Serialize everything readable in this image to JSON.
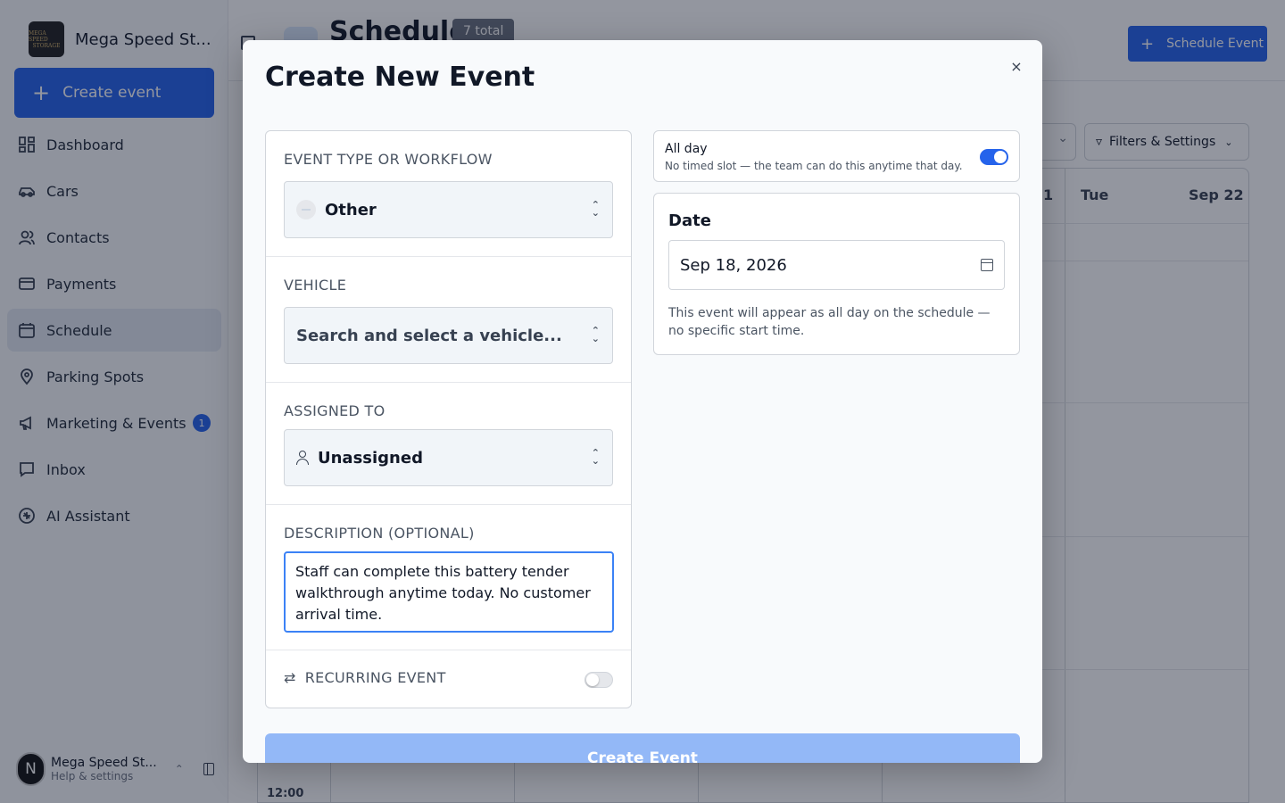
{
  "sidebar": {
    "brand_name": "Mega Speed St...",
    "logo_text": [
      "MEGA SPEED",
      "STORAGE"
    ],
    "create_label": "Create event",
    "items": [
      {
        "label": "Dashboard",
        "icon": "dashboard-icon"
      },
      {
        "label": "Cars",
        "icon": "car-icon"
      },
      {
        "label": "Contacts",
        "icon": "contacts-icon"
      },
      {
        "label": "Payments",
        "icon": "payments-icon"
      },
      {
        "label": "Schedule",
        "icon": "calendar-icon",
        "active": true
      },
      {
        "label": "Parking Spots",
        "icon": "map-pin-icon"
      },
      {
        "label": "Marketing & Events",
        "icon": "megaphone-icon",
        "badge": "1"
      },
      {
        "label": "Inbox",
        "icon": "inbox-icon"
      },
      {
        "label": "AI Assistant",
        "icon": "ai-icon"
      }
    ],
    "user": {
      "initial": "N",
      "name": "Mega Speed St...",
      "sub": "Help & settings"
    }
  },
  "page": {
    "title": "Schedule",
    "total_badge": "7 total",
    "schedule_button": "Schedule Event",
    "filters_button": "Filters & Settings"
  },
  "calendar": {
    "partial_day_digit": "1",
    "day_name": "Tue",
    "day_date": "Sep 22",
    "time_label": "12:00"
  },
  "modal": {
    "title": "Create New Event",
    "close_label": "×",
    "event_type_label": "EVENT TYPE OR WORKFLOW",
    "event_type_value": "Other",
    "vehicle_label": "VEHICLE",
    "vehicle_placeholder": "Search and select a vehicle...",
    "assigned_label": "ASSIGNED TO",
    "assigned_value": "Unassigned",
    "description_label": "DESCRIPTION (OPTIONAL)",
    "description_value": "Staff can complete this battery tender walkthrough anytime today. No customer arrival time.",
    "recurring_label": "RECURRING EVENT",
    "recurring_enabled": false,
    "all_day_title": "All day",
    "all_day_subtitle": "No timed slot — the team can do this anytime that day.",
    "all_day_enabled": true,
    "date_label": "Date",
    "date_value": "Sep 18, 2026",
    "date_help": "This event will appear as all day on the schedule — no specific start time.",
    "submit_label": "Create Event"
  },
  "colors": {
    "accent": "#2563eb",
    "active_nav": "#e2e8f0",
    "submit_disabled": "#93b8f7"
  }
}
